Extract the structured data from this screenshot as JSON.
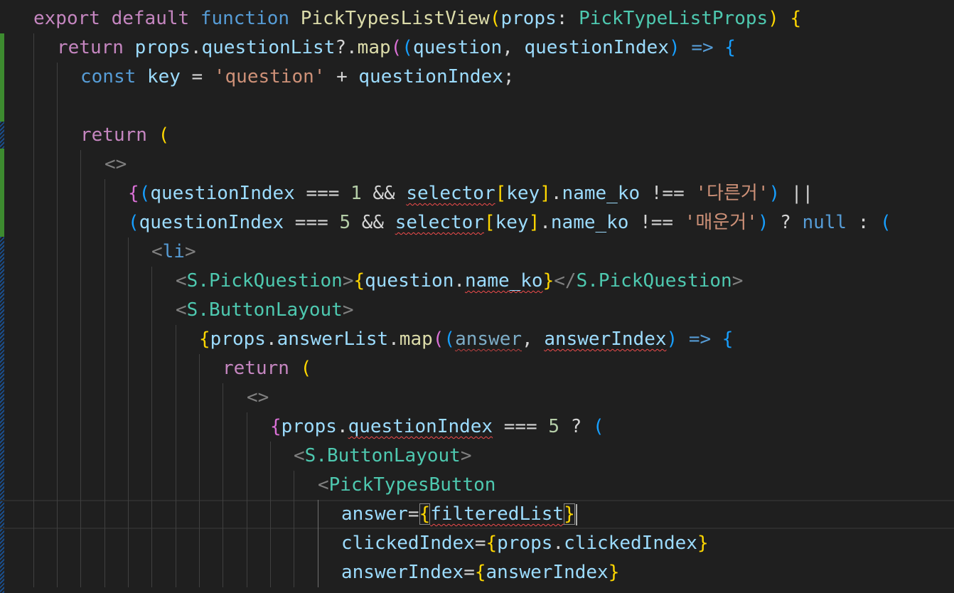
{
  "editor": {
    "theme_background": "#1f1f1f",
    "git_modified_color": "#3d8b2f",
    "git_added_color": "#1a4d8a"
  },
  "code": {
    "l1": {
      "t1": "export",
      "t2": " ",
      "t3": "default",
      "t4": " ",
      "t5": "function",
      "t6": " ",
      "t7": "PickTypesListView",
      "t8": "(",
      "t9": "props",
      "t10": ": ",
      "t11": "PickTypeListProps",
      "t12": ")",
      "t13": " ",
      "t14": "{"
    },
    "l2": {
      "t1": "return",
      "t2": " ",
      "t3": "props",
      "t4": ".",
      "t5": "questionList",
      "t6": "?.",
      "t7": "map",
      "t8": "(",
      "t9": "(",
      "t10": "question",
      "t11": ", ",
      "t12": "questionIndex",
      "t13": ")",
      "t14": " ",
      "t15": "=>",
      "t16": " ",
      "t17": "{"
    },
    "l3": {
      "t1": "const",
      "t2": " ",
      "t3": "key",
      "t4": " = ",
      "t5": "'question'",
      "t6": " + ",
      "t7": "questionIndex",
      "t8": ";"
    },
    "l5": {
      "t1": "return",
      "t2": " ",
      "t3": "("
    },
    "l6": {
      "t1": "<>"
    },
    "l7": {
      "t1": "{",
      "t2": "(",
      "t3": "questionIndex",
      "t4": " === ",
      "t5": "1",
      "t6": " && ",
      "t7": "selector",
      "t8": "[",
      "t9": "key",
      "t10": "]",
      "t11": ".",
      "t12": "name_ko",
      "t13": " !== ",
      "t14": "'다른거'",
      "t15": ")",
      "t16": " ||"
    },
    "l8": {
      "t1": "(",
      "t2": "questionIndex",
      "t3": " === ",
      "t4": "5",
      "t5": " && ",
      "t6": "selector",
      "t7": "[",
      "t8": "key",
      "t9": "]",
      "t10": ".",
      "t11": "name_ko",
      "t12": " !== ",
      "t13": "'매운거'",
      "t14": ")",
      "t15": " ? ",
      "t16": "null",
      "t17": " : ",
      "t18": "("
    },
    "l9": {
      "t1": "<",
      "t2": "li",
      "t3": ">"
    },
    "l10": {
      "t1": "<",
      "t2": "S",
      "t3": ".",
      "t4": "PickQuestion",
      "t5": ">",
      "t6": "{",
      "t7": "question",
      "t8": ".",
      "t9": "name_ko",
      "t10": "}",
      "t11": "</",
      "t12": "S",
      "t13": ".",
      "t14": "PickQuestion",
      "t15": ">"
    },
    "l11": {
      "t1": "<",
      "t2": "S",
      "t3": ".",
      "t4": "ButtonLayout",
      "t5": ">"
    },
    "l12": {
      "t1": "{",
      "t2": "props",
      "t3": ".",
      "t4": "answerList",
      "t5": ".",
      "t6": "map",
      "t7": "(",
      "t8": "(",
      "t9": "answer",
      "t10": ", ",
      "t11": "answerIndex",
      "t12": ")",
      "t13": " ",
      "t14": "=>",
      "t15": " ",
      "t16": "{"
    },
    "l13": {
      "t1": "return",
      "t2": " ",
      "t3": "("
    },
    "l14": {
      "t1": "<>"
    },
    "l15": {
      "t1": "{",
      "t2": "props",
      "t3": ".",
      "t4": "questionIndex",
      "t5": " === ",
      "t6": "5",
      "t7": " ? ",
      "t8": "("
    },
    "l16": {
      "t1": "<",
      "t2": "S",
      "t3": ".",
      "t4": "ButtonLayout",
      "t5": ">"
    },
    "l17": {
      "t1": "<",
      "t2": "PickTypesButton"
    },
    "l18": {
      "t1": "answer",
      "t2": "=",
      "t3": "{",
      "t4": "filteredList",
      "t5": "}"
    },
    "l19": {
      "t1": "clickedIndex",
      "t2": "=",
      "t3": "{",
      "t4": "props",
      "t5": ".",
      "t6": "clickedIndex",
      "t7": "}"
    },
    "l20": {
      "t1": "answerIndex",
      "t2": "=",
      "t3": "{",
      "t4": "answerIndex",
      "t5": "}"
    }
  }
}
